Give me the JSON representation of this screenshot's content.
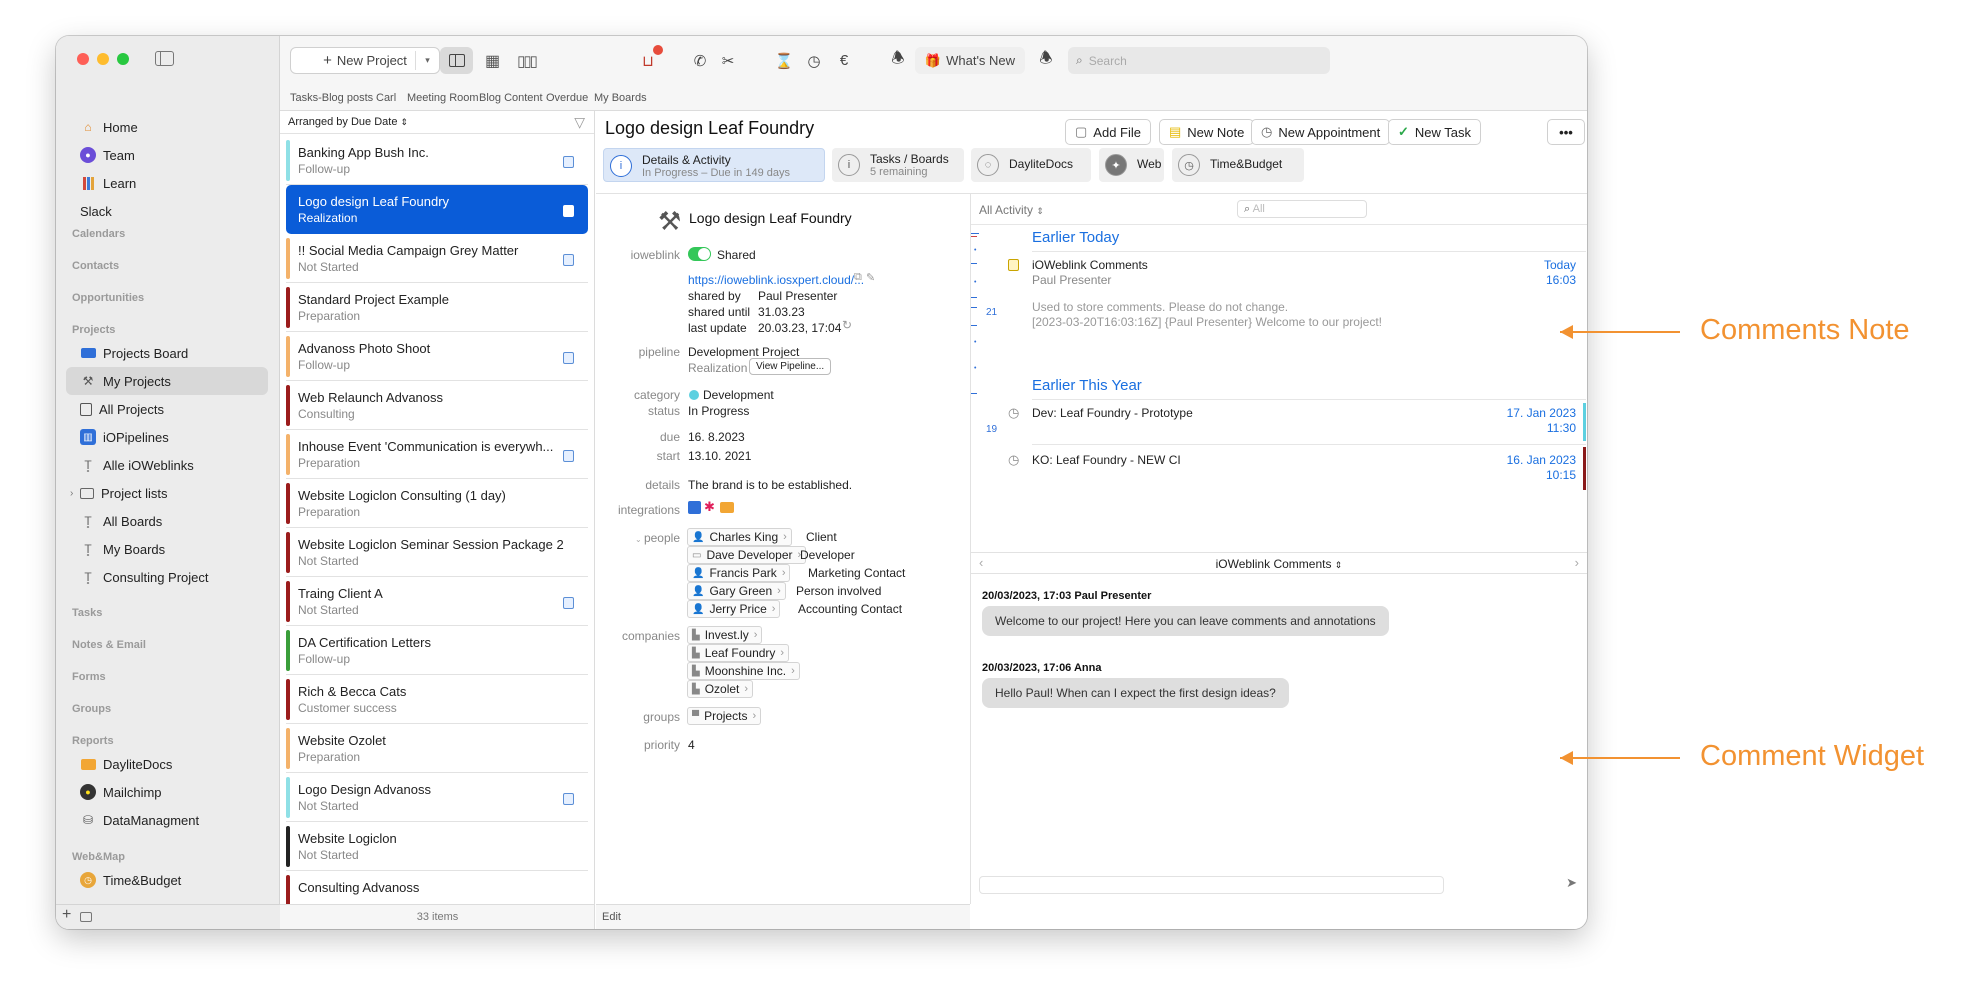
{
  "toolbar": {
    "new_project": "New Project",
    "whats_new": "What's New",
    "search_placeholder": "Search"
  },
  "favorites": [
    "Tasks-Blog posts",
    "Carl",
    "Meeting Room",
    "Blog Content",
    "Overdue",
    "My Boards"
  ],
  "sidebar": {
    "top": [
      {
        "label": "Home",
        "icon": "home-icon"
      },
      {
        "label": "Team",
        "icon": "team-icon"
      },
      {
        "label": "Learn",
        "icon": "books-icon"
      },
      {
        "label": "Slack",
        "icon": ""
      }
    ],
    "sections": {
      "calendars": "Calendars",
      "contacts": "Contacts",
      "opportunities": "Opportunities",
      "projects": "Projects",
      "tasks": "Tasks",
      "notes": "Notes & Email",
      "forms": "Forms",
      "groups": "Groups",
      "reports": "Reports",
      "webmap": "Web&Map"
    },
    "project_items": [
      "Projects Board",
      "My Projects",
      "All Projects",
      "iOPipelines",
      "Alle iOWeblinks",
      "Project lists",
      "All Boards",
      "My Boards",
      "Consulting Project"
    ],
    "report_items": [
      "DayliteDocs",
      "Mailchimp",
      "DataManagment"
    ],
    "web_items": [
      "Time&Budget"
    ]
  },
  "list": {
    "sort": "Arranged by Due Date",
    "count": "33 items",
    "items": [
      {
        "title": "Banking App Bush Inc.",
        "status": "Follow-up",
        "color": "#8fe0e6",
        "note": true
      },
      {
        "title": "Logo design Leaf Foundry",
        "status": "Realization",
        "color": "#0a5cd8",
        "note": true
      },
      {
        "title": "!! Social Media Campaign Grey Matter",
        "status": "Not Started",
        "color": "#f4b26a",
        "note": true
      },
      {
        "title": "Standard Project Example",
        "status": "Preparation",
        "color": "#9b1c1c",
        "note": false
      },
      {
        "title": "Advanoss Photo Shoot",
        "status": "Follow-up",
        "color": "#f4b26a",
        "note": true
      },
      {
        "title": "Web Relaunch Advanoss",
        "status": "Consulting",
        "color": "#9b1c1c",
        "note": false
      },
      {
        "title": "Inhouse Event 'Communication is everywh...",
        "status": "Preparation",
        "color": "#f4b26a",
        "note": true
      },
      {
        "title": "Website Logiclon Consulting (1 day)",
        "status": "Preparation",
        "color": "#9b1c1c",
        "note": false
      },
      {
        "title": "Website Logiclon Seminar Session Package 2",
        "status": "Not Started",
        "color": "#9b1c1c",
        "note": false
      },
      {
        "title": "Traing Client A",
        "status": "Not Started",
        "color": "#9b1c1c",
        "note": true
      },
      {
        "title": "DA Certification Letters",
        "status": "Follow-up",
        "color": "#3a9e3a",
        "note": false
      },
      {
        "title": "Rich & Becca Cats",
        "status": "Customer success",
        "color": "#9b1c1c",
        "note": false
      },
      {
        "title": "Website Ozolet",
        "status": "Preparation",
        "color": "#f4b26a",
        "note": false
      },
      {
        "title": "Logo Design Advanoss",
        "status": "Not Started",
        "color": "#8fe0e6",
        "note": true
      },
      {
        "title": "Website Logiclon",
        "status": "Not Started",
        "color": "#222222",
        "note": false
      },
      {
        "title": "Consulting Advanoss",
        "status": "",
        "color": "#9b1c1c",
        "note": false
      }
    ]
  },
  "detail": {
    "title": "Logo design Leaf Foundry",
    "buttons": {
      "add_file": "Add File",
      "new_note": "New Note",
      "new_appointment": "New Appointment",
      "new_task": "New Task",
      "more": "•••"
    },
    "tabs": [
      {
        "a": "Details & Activity",
        "b": "In Progress – Due in 149 days"
      },
      {
        "a": "Tasks / Boards",
        "b": "5 remaining"
      },
      {
        "a": "DayliteDocs",
        "b": ""
      },
      {
        "a": "Web",
        "b": ""
      },
      {
        "a": "Time&Budget",
        "b": ""
      }
    ],
    "name": "Logo design Leaf Foundry",
    "ioweblink_label": "ioweblink",
    "shared": "Shared",
    "link": "https://ioweblink.iosxpert.cloud/...",
    "shared_by_label": "shared by",
    "shared_by": "Paul Presenter",
    "shared_until_label": "shared until",
    "shared_until": "31.03.23",
    "last_update_label": "last update",
    "last_update": "20.03.23, 17:04",
    "pipeline_label": "pipeline",
    "pipeline": "Development Project",
    "stage": "Realization",
    "view_pipeline": "View Pipeline...",
    "category_label": "category",
    "category": "Development",
    "status_label": "status",
    "status": "In Progress",
    "due_label": "due",
    "due": "16. 8.2023",
    "start_label": "start",
    "start": "13.10. 2021",
    "details_label": "details",
    "details": "The brand is to be established.",
    "integrations_label": "integrations",
    "people_label": "people",
    "people": [
      {
        "name": "Charles King",
        "role": "Client"
      },
      {
        "name": "Dave Developer",
        "role": "Developer"
      },
      {
        "name": "Francis Park",
        "role": "Marketing Contact"
      },
      {
        "name": "Gary Green",
        "role": "Person involved"
      },
      {
        "name": "Jerry Price",
        "role": "Accounting Contact"
      }
    ],
    "companies_label": "companies",
    "companies": [
      "Invest.ly",
      "Leaf Foundry",
      "Moonshine Inc.",
      "Ozolet"
    ],
    "groups_label": "groups",
    "group": "Projects",
    "priority_label": "priority",
    "priority": "4",
    "edit": "Edit"
  },
  "activity": {
    "filter": "All Activity",
    "search_placeholder": "All",
    "section1": "Earlier Today",
    "note_title": "iOWeblink Comments",
    "note_author": "Paul Presenter",
    "note_day": "Today",
    "note_time": "16:03",
    "note_body1": "Used to store comments. Please do not change.",
    "note_body2": "[2023-03-20T16:03:16Z] {Paul Presenter} Welcome to our project!",
    "section2": "Earlier This Year",
    "ev1": "Dev: Leaf Foundry - Prototype",
    "ev1_date": "17. Jan 2023",
    "ev1_time": "11:30",
    "ev2": "KO: Leaf Foundry - NEW CI",
    "ev2_date": "16. Jan 2023",
    "ev2_time": "10:15",
    "mini_21": "21",
    "mini_19": "19"
  },
  "comments": {
    "header": "iOWeblink Comments",
    "c1_meta": "20/03/2023, 17:03 Paul Presenter",
    "c1": "Welcome to our project! Here you can leave comments and annotations",
    "c2_meta": "20/03/2023, 17:06 Anna",
    "c2": "Hello Paul! When can I expect the first design ideas?"
  },
  "annotations": {
    "a1": "Comments Note",
    "a2": "Comment Widget"
  },
  "colors": {
    "accent": "#0a5cd8",
    "orange": "#f29231",
    "link": "#1a6fe0"
  }
}
